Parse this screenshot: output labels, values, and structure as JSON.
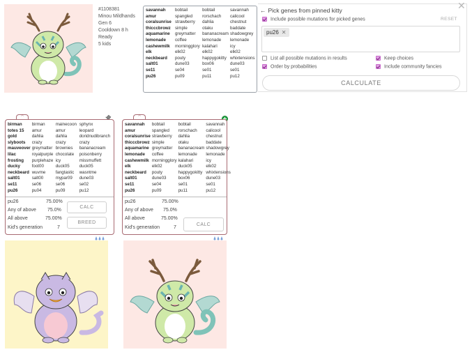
{
  "top_kitty": {
    "id": "#1108381",
    "name": "Minou Mildhands",
    "gen": "Gen 6",
    "cooldown": "Cooldown 8 h",
    "status": "Ready",
    "kids": "5 kids",
    "genes": [
      [
        "savannah",
        "bobtail",
        "bobtail",
        "savannah"
      ],
      [
        "amur",
        "spangled",
        "rorschach",
        "calicool"
      ],
      [
        "coralsunrise",
        "strawberry",
        "dahlia",
        "chestnut"
      ],
      [
        "thicccbrowz",
        "simple",
        "otaku",
        "baddate"
      ],
      [
        "aquamarine",
        "greymatter",
        "bananacream",
        "shadowgrey"
      ],
      [
        "lemonade",
        "coffee",
        "lemonade",
        "lemonade"
      ],
      [
        "cashewmilk",
        "morningglory",
        "kalahari",
        "icy"
      ],
      [
        "elk",
        "elk02",
        "elk02",
        "elk02"
      ],
      [
        "neckbeard",
        "pouty",
        "happygokitty",
        "whixtensions"
      ],
      [
        "salt01",
        "dune03",
        "box06",
        "dune03"
      ],
      [
        "se11",
        "se04",
        "se01",
        "se01"
      ],
      [
        "pu26",
        "pu09",
        "pu11",
        "pu12"
      ]
    ]
  },
  "panel": {
    "title": "Pick genes from pinned kitty",
    "arrow": "←",
    "close": "✕",
    "reset": "RESET",
    "include_mutations": "Include possible mutations for picked genes",
    "selected_tag": "pu26",
    "tag_remove": "✕",
    "list_all": "List all possible mutations in results",
    "order_prob": "Order by probabilities",
    "keep_choices": "Keep choices",
    "include_community": "Include community fancies",
    "calculate": "CALCULATE"
  },
  "card1": {
    "collapse": "^",
    "pin": "pin",
    "genes": [
      [
        "birman",
        "birman",
        "mainecoon",
        "sphynx"
      ],
      [
        "totes 15",
        "amur",
        "amur",
        "leopard"
      ],
      [
        "gold",
        "dahlia",
        "dahlia",
        "doridnudibranch"
      ],
      [
        "slyboots",
        "crazy",
        "crazy",
        "crazy"
      ],
      [
        "mauveover",
        "greymatter",
        "brownies",
        "bananacream"
      ],
      [
        "lilac",
        "royalpurple",
        "chocolate",
        "poisonberry"
      ],
      [
        "frosting",
        "purplehaze",
        "icy",
        "missmuffett"
      ],
      [
        "ducky",
        "foot00",
        "duck05",
        "duck05"
      ],
      [
        "neckbeard",
        "wuvme",
        "fangtastic",
        "wasntme"
      ],
      [
        "salt01",
        "salt00",
        "mypar09",
        "dune03"
      ],
      [
        "se11",
        "se06",
        "se06",
        "se02"
      ],
      [
        "pu26",
        "pu04",
        "pu09",
        "pu12"
      ]
    ],
    "gene": "pu26",
    "gene_pct": "75.00%",
    "any_label": "Any of above",
    "any_pct": "75.0%",
    "all_label": "All above",
    "all_pct": "75.00%",
    "kid_gen_label": "Kid's generation",
    "kid_gen": "7",
    "calc": "CALC",
    "breed": "BREED"
  },
  "card2": {
    "collapse": "^",
    "genes": [
      [
        "savannah",
        "bobtail",
        "bobtail",
        "savannah"
      ],
      [
        "amur",
        "spangled",
        "rorschach",
        "calicool"
      ],
      [
        "coralsunrise",
        "strawberry",
        "dahlia",
        "chestnut"
      ],
      [
        "thicccbrowz",
        "simple",
        "otaku",
        "baddate"
      ],
      [
        "aquamarine",
        "greymatter",
        "bananacream",
        "shadowgrey"
      ],
      [
        "lemonade",
        "coffee",
        "lemonade",
        "lemonade"
      ],
      [
        "cashewmilk",
        "morningglory",
        "kalahari",
        "icy"
      ],
      [
        "elk",
        "elk02",
        "duck05",
        "elk02"
      ],
      [
        "neckbeard",
        "pouty",
        "happygokitty",
        "whixtensions"
      ],
      [
        "salt01",
        "dune03",
        "box06",
        "dune03"
      ],
      [
        "se11",
        "se04",
        "se01",
        "se01"
      ],
      [
        "pu26",
        "pu09",
        "pu11",
        "pu12"
      ]
    ],
    "gene": "pu26",
    "gene_pct": "75.00%",
    "any_label": "Any of above",
    "any_pct": "75.0%",
    "all_label": "All above",
    "all_pct": "75.00%",
    "kid_gen_label": "Kid's generation",
    "kid_gen": "7",
    "calc": "CALC"
  },
  "colors": {
    "kitty_bg_pink": "#fde8e4",
    "kitty_bg_yellow": "#fdf5c8",
    "card_border": "#a86a72",
    "checkbox_on": "#e0a0e2",
    "pin_green": "#22aa44"
  }
}
